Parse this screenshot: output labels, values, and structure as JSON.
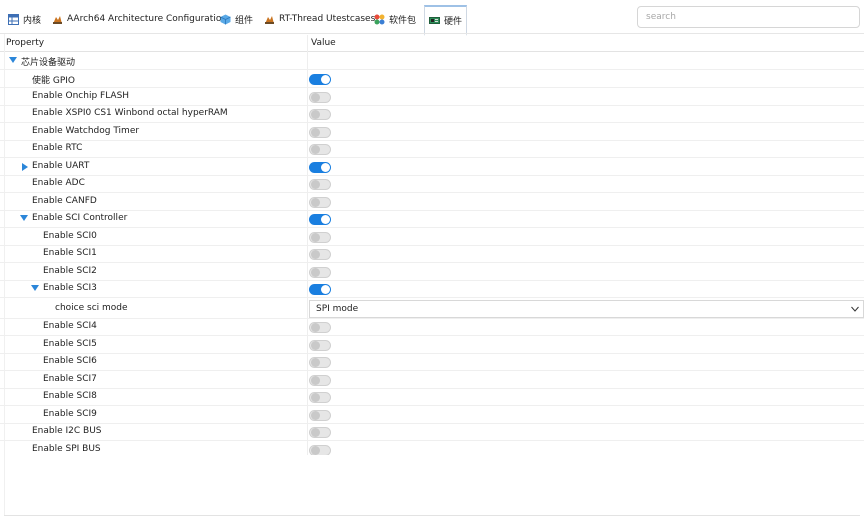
{
  "tabs": [
    {
      "label": "内核",
      "icon": "table-icon",
      "active": false
    },
    {
      "label": "AArch64 Architecture Configuration",
      "icon": "chip-icon",
      "active": false
    },
    {
      "label": "组件",
      "icon": "cube-icon",
      "active": false
    },
    {
      "label": "RT-Thread Utestcases",
      "icon": "chip-icon",
      "active": false
    },
    {
      "label": "软件包",
      "icon": "packages-icon",
      "active": false
    },
    {
      "label": "硬件",
      "icon": "board-icon",
      "active": true
    }
  ],
  "search": {
    "placeholder": "search"
  },
  "columns": {
    "property": "Property",
    "value": "Value"
  },
  "rows": [
    {
      "label": "芯片设备驱动",
      "expander": "down",
      "control": "none"
    },
    {
      "label": "使能 GPIO",
      "control": "toggle",
      "on": true
    },
    {
      "label": "Enable Onchip FLASH",
      "control": "toggle",
      "on": false
    },
    {
      "label": "Enable XSPI0 CS1 Winbond octal hyperRAM",
      "control": "toggle",
      "on": false
    },
    {
      "label": "Enable Watchdog Timer",
      "control": "toggle",
      "on": false
    },
    {
      "label": "Enable RTC",
      "control": "toggle",
      "on": false
    },
    {
      "label": "Enable UART",
      "expander": "right",
      "control": "toggle",
      "on": true
    },
    {
      "label": "Enable ADC",
      "control": "toggle",
      "on": false
    },
    {
      "label": "Enable CANFD",
      "control": "toggle",
      "on": false
    },
    {
      "label": "Enable SCI Controller",
      "expander": "down",
      "control": "toggle",
      "on": true
    },
    {
      "label": "Enable SCI0",
      "control": "toggle",
      "on": false
    },
    {
      "label": "Enable SCI1",
      "control": "toggle",
      "on": false
    },
    {
      "label": "Enable SCI2",
      "control": "toggle",
      "on": false
    },
    {
      "label": "Enable SCI3",
      "expander": "down",
      "control": "toggle",
      "on": true
    },
    {
      "label": "choice sci mode",
      "control": "select",
      "value": "SPI mode"
    },
    {
      "label": "Enable SCI4",
      "control": "toggle",
      "on": false
    },
    {
      "label": "Enable SCI5",
      "control": "toggle",
      "on": false
    },
    {
      "label": "Enable SCI6",
      "control": "toggle",
      "on": false
    },
    {
      "label": "Enable SCI7",
      "control": "toggle",
      "on": false
    },
    {
      "label": "Enable SCI8",
      "control": "toggle",
      "on": false
    },
    {
      "label": "Enable SCI9",
      "control": "toggle",
      "on": false
    },
    {
      "label": "Enable I2C BUS",
      "control": "toggle",
      "on": false
    },
    {
      "label": "Enable SPI BUS",
      "control": "toggle",
      "on": false
    }
  ],
  "colors": {
    "accent": "#1a7fe0",
    "expander": "#2b86d9"
  }
}
